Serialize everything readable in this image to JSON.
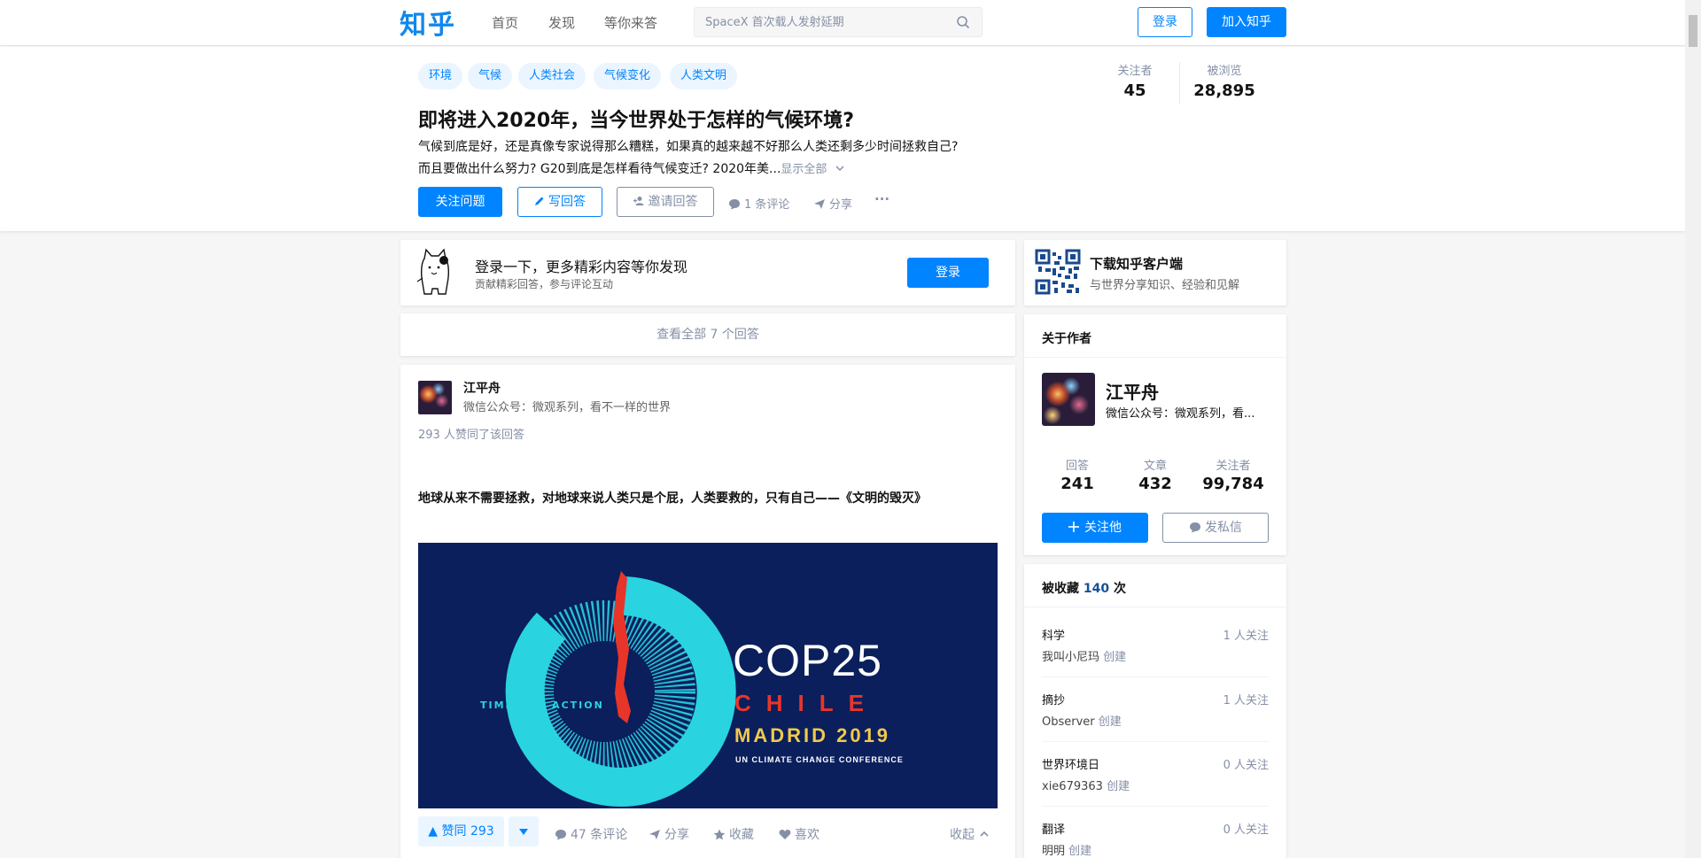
{
  "header": {
    "logo": "知乎",
    "nav": [
      "首页",
      "发现",
      "等你来答"
    ],
    "search_placeholder": "SpaceX 首次载人发射延期",
    "login": "登录",
    "join": "加入知乎"
  },
  "question": {
    "topics": [
      "环境",
      "气候",
      "人类社会",
      "气候变化",
      "人类文明"
    ],
    "title": "即将进入2020年，当今世界处于怎样的气候环境?",
    "desc_line1": "气候到底是好，还是真像专家说得那么糟糕，如果真的越来越不好那么人类还剩多少时间拯救自己?",
    "desc_line2": "而且要做出什么努力? G20到底是怎样看待气候变迁? 2020年美...",
    "show_all": "显示全部",
    "followers_label": "关注者",
    "followers": "45",
    "views_label": "被浏览",
    "views": "28,895",
    "follow_btn": "关注问题",
    "write_btn": "写回答",
    "invite_btn": "邀请回答",
    "comments": "1 条评论",
    "share": "分享",
    "more": "···"
  },
  "login_prompt": {
    "title": "登录一下，更多精彩内容等你发现",
    "subtitle": "贡献精彩回答，参与评论互动",
    "button": "登录"
  },
  "view_all": "查看全部 7 个回答",
  "answer": {
    "author": "江平舟",
    "headline": "微信公众号：微观系列，看不一样的世界",
    "votes_text": "293 人赞同了该回答",
    "content": "地球从来不需要拯救，对地球来说人类只是个屁，人类要救的，只有自己——《文明的毁灭》",
    "image": {
      "cop": "COP25",
      "country": "CHILE",
      "city": "MADRID 2019",
      "sub": "UN CLIMATE CHANGE CONFERENCE",
      "time": "TIME FOR ACTION"
    },
    "upvote": "▲ 赞同 293",
    "comments": "47 条评论",
    "share": "分享",
    "collect": "收藏",
    "like": "喜欢",
    "collapse": "收起"
  },
  "download": {
    "title": "下载知乎客户端",
    "subtitle": "与世界分享知识、经验和见解"
  },
  "about": {
    "heading": "关于作者",
    "name": "江平舟",
    "headline": "微信公众号：微观系列，看...",
    "stats": [
      {
        "label": "回答",
        "value": "241"
      },
      {
        "label": "文章",
        "value": "432"
      },
      {
        "label": "关注者",
        "value": "99,784"
      }
    ],
    "follow_btn": "关注他",
    "message_btn": "发私信"
  },
  "collections": {
    "heading_pre": "被收藏",
    "count": "140",
    "heading_post": "次",
    "items": [
      {
        "name": "科学",
        "followers": "1 人关注",
        "creator": "我叫小尼玛",
        "created": "创建"
      },
      {
        "name": "摘抄",
        "followers": "1 人关注",
        "creator": "Observer",
        "created": "创建"
      },
      {
        "name": "世界环境日",
        "followers": "0 人关注",
        "creator": "xie679363",
        "created": "创建"
      },
      {
        "name": "翻译",
        "followers": "0 人关注",
        "creator": "明明",
        "created": "创建"
      }
    ]
  },
  "colors": {
    "brand": "#0084ff",
    "gray": "#8590a6",
    "cop_bg": "#0a1f5c",
    "cop_ring": "#2ad3e0",
    "cop_red": "#e8352a",
    "cop_gold": "#f2c94c"
  }
}
